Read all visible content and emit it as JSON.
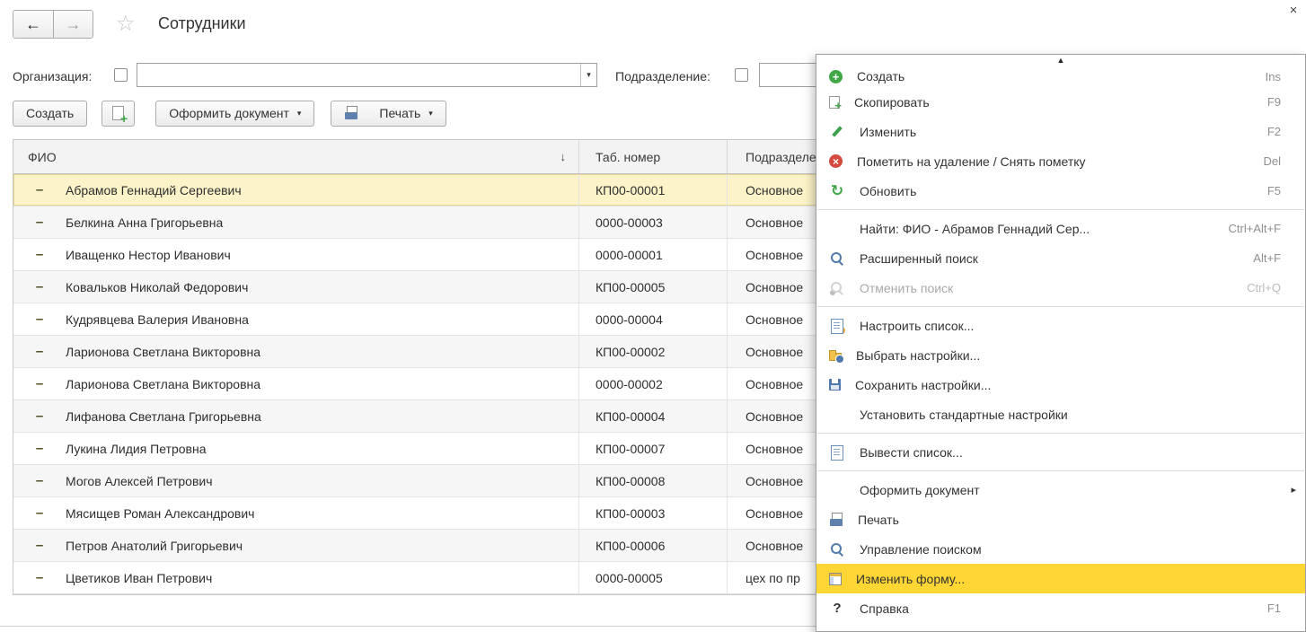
{
  "window": {
    "title": "Сотрудники"
  },
  "ui": {
    "back_icon": "←",
    "forward_icon": "→",
    "star_icon": "☆",
    "close_icon": "×",
    "dropdown_icon": "▾",
    "submenu_icon": "▸",
    "scroll_up_icon": "▲",
    "sort_icon": "↓",
    "row_marker": "–"
  },
  "colors": {
    "selected_row": "#fcf3c8",
    "menu_highlight": "#ffd633",
    "accent_green": "#3fa748",
    "accent_blue": "#4f79ad",
    "accent_red": "#d54a3f"
  },
  "filters": {
    "organization_label": "Организация:",
    "organization_value": "",
    "department_label": "Подразделение:",
    "department_value": ""
  },
  "toolbar": {
    "create_label": "Создать",
    "document_label": "Оформить документ",
    "print_label": "Печать"
  },
  "table": {
    "columns": [
      "ФИО",
      "Таб. номер",
      "Подразделение"
    ],
    "rows": [
      {
        "name": "Абрамов Геннадий Сергеевич",
        "number": "КП00-00001",
        "department": "Основное",
        "selected": true
      },
      {
        "name": "Белкина Анна Григорьевна",
        "number": "0000-00003",
        "department": "Основное"
      },
      {
        "name": "Иващенко Нестор Иванович",
        "number": "0000-00001",
        "department": "Основное"
      },
      {
        "name": "Ковальков Николай Федорович",
        "number": "КП00-00005",
        "department": "Основное"
      },
      {
        "name": "Кудрявцева Валерия Ивановна",
        "number": "0000-00004",
        "department": "Основное"
      },
      {
        "name": "Ларионова Светлана Викторовна",
        "number": "КП00-00002",
        "department": "Основное"
      },
      {
        "name": "Ларионова Светлана Викторовна",
        "number": "0000-00002",
        "department": "Основное"
      },
      {
        "name": "Лифанова Светлана Григорьевна",
        "number": "КП00-00004",
        "department": "Основное"
      },
      {
        "name": "Лукина Лидия Петровна",
        "number": "КП00-00007",
        "department": "Основное"
      },
      {
        "name": "Могов Алексей Петрович",
        "number": "КП00-00008",
        "department": "Основное"
      },
      {
        "name": "Мясищев Роман Александрович",
        "number": "КП00-00003",
        "department": "Основное"
      },
      {
        "name": "Петров Анатолий Григорьевич",
        "number": "КП00-00006",
        "department": "Основное"
      },
      {
        "name": "Цветиков Иван Петрович",
        "number": "0000-00005",
        "department": "цех  по пр"
      }
    ]
  },
  "context_menu": {
    "items": [
      {
        "icon": "create",
        "label": "Создать",
        "shortcut": "Ins",
        "partial": true
      },
      {
        "icon": "copy",
        "label": "Скопировать",
        "shortcut": "F9"
      },
      {
        "icon": "edit",
        "label": "Изменить",
        "shortcut": "F2"
      },
      {
        "icon": "delete",
        "label": "Пометить на удаление / Снять пометку",
        "shortcut": "Del"
      },
      {
        "icon": "refresh",
        "label": "Обновить",
        "shortcut": "F5"
      },
      {
        "type": "separator"
      },
      {
        "label": "Найти: ФИО - Абрамов Геннадий Сер...",
        "shortcut": "Ctrl+Alt+F"
      },
      {
        "icon": "search",
        "label": "Расширенный поиск",
        "shortcut": "Alt+F"
      },
      {
        "icon": "cancel-search",
        "label": "Отменить поиск",
        "shortcut": "Ctrl+Q",
        "disabled": true
      },
      {
        "type": "separator"
      },
      {
        "icon": "configure-list",
        "label": "Настроить список..."
      },
      {
        "icon": "choose-settings",
        "label": "Выбрать настройки..."
      },
      {
        "icon": "save-settings",
        "label": "Сохранить настройки..."
      },
      {
        "label": "Установить стандартные настройки"
      },
      {
        "type": "separator"
      },
      {
        "icon": "output-list",
        "label": "Вывести список..."
      },
      {
        "type": "separator"
      },
      {
        "label": "Оформить документ",
        "submenu": true
      },
      {
        "icon": "print",
        "label": "Печать"
      },
      {
        "icon": "search-manage",
        "label": "Управление поиском"
      },
      {
        "icon": "change-form",
        "label": "Изменить форму...",
        "highlighted": true
      },
      {
        "icon": "help",
        "label": "Справка",
        "shortcut": "F1"
      }
    ]
  }
}
